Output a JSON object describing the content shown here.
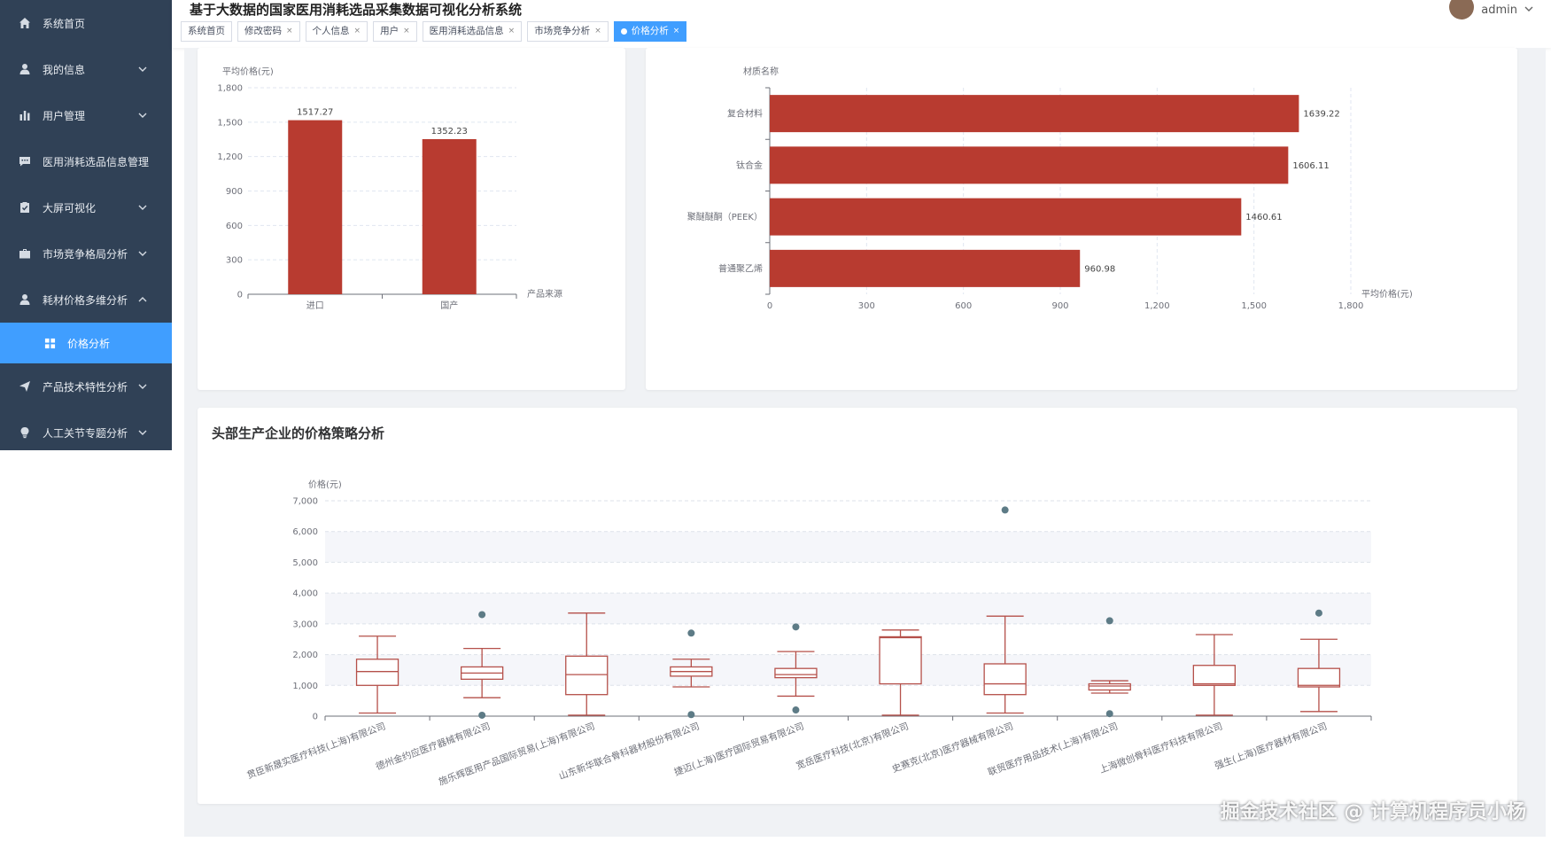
{
  "app": {
    "title": "基于大数据的国家医用消耗选品采集数据可视化分析系统",
    "user": "admin"
  },
  "sidebar": {
    "items": [
      {
        "label": "系统首页",
        "icon": "home-icon",
        "arrow": false
      },
      {
        "label": "我的信息",
        "icon": "user-icon",
        "arrow": true
      },
      {
        "label": "用户管理",
        "icon": "bar-chart-icon",
        "arrow": true
      },
      {
        "label": "医用消耗选品信息管理",
        "icon": "chat-icon",
        "arrow": false
      },
      {
        "label": "大屏可视化",
        "icon": "clipboard-icon",
        "arrow": true
      },
      {
        "label": "市场竞争格局分析",
        "icon": "briefcase-icon",
        "arrow": true
      },
      {
        "label": "耗材价格多维分析",
        "icon": "user-icon",
        "arrow": true,
        "expanded": true
      }
    ],
    "active_sub": {
      "label": "价格分析",
      "icon": "grid-icon"
    },
    "items_after": [
      {
        "label": "产品技术特性分析",
        "icon": "send-icon",
        "arrow": true
      },
      {
        "label": "人工关节专题分析",
        "icon": "bulb-icon",
        "arrow": true
      }
    ]
  },
  "tags": [
    {
      "label": "系统首页",
      "closable": false,
      "active": false
    },
    {
      "label": "修改密码",
      "closable": true,
      "active": false
    },
    {
      "label": "个人信息",
      "closable": true,
      "active": false
    },
    {
      "label": "用户",
      "closable": true,
      "active": false
    },
    {
      "label": "医用消耗选品信息",
      "closable": true,
      "active": false
    },
    {
      "label": "市场竞争分析",
      "closable": true,
      "active": false
    },
    {
      "label": "价格分析",
      "closable": true,
      "active": true
    }
  ],
  "close_glyph": "×",
  "chart_data": [
    {
      "type": "bar",
      "ylabel": "平均价格(元)",
      "xlabel": "产品来源",
      "categories": [
        "进口",
        "国产"
      ],
      "values": [
        1517.27,
        1352.23
      ],
      "value_labels": [
        "1517.27",
        "1352.23"
      ],
      "ylim": [
        0,
        1800
      ],
      "yticks": [
        "0",
        "300",
        "600",
        "900",
        "1,200",
        "1,500",
        "1,800"
      ],
      "ytick_values": [
        0,
        300,
        600,
        900,
        1200,
        1500,
        1800
      ],
      "color": "#b83b30"
    },
    {
      "type": "bar",
      "orientation": "horizontal",
      "ylabel": "材质名称",
      "xlabel": "平均价格(元)",
      "categories": [
        "复合材料",
        "钛合金",
        "聚醚醚酮（PEEK）",
        "普通聚乙烯"
      ],
      "values": [
        1639.22,
        1606.11,
        1460.61,
        960.98
      ],
      "value_labels": [
        "1639.22",
        "1606.11",
        "1460.61",
        "960.98"
      ],
      "xlim": [
        0,
        1800
      ],
      "xticks": [
        "0",
        "300",
        "600",
        "900",
        "1,200",
        "1,500",
        "1,800"
      ],
      "xtick_values": [
        0,
        300,
        600,
        900,
        1200,
        1500,
        1800
      ],
      "color": "#b83b30"
    },
    {
      "type": "boxplot",
      "title": "头部生产企业的价格策略分析",
      "ylabel": "价格(元)",
      "ylim": [
        0,
        7000
      ],
      "yticks": [
        "0",
        "1,000",
        "2,000",
        "3,000",
        "4,000",
        "5,000",
        "6,000",
        "7,000"
      ],
      "ytick_values": [
        0,
        1000,
        2000,
        3000,
        4000,
        5000,
        6000,
        7000
      ],
      "color": "#b5504a",
      "outlier_color": "#5d7b86",
      "categories": [
        "贯臣新晟实医疗科技(上海)有限公司",
        "德州金约应医疗器械有限公司",
        "施乐辉医用产品国际贸易(上海)有限公司",
        "山东新华联合骨科器材股份有限公司",
        "捷迈(上海)医疗国际贸易有限公司",
        "宽岳医疗科技(北京)有限公司",
        "史赛克(北京)医疗器械有限公司",
        "联贸医疗用品技术(上海)有限公司",
        "上海微创骨科医疗科技有限公司",
        "强生(上海)医疗器材有限公司"
      ],
      "boxes": [
        {
          "min": 100,
          "q1": 1000,
          "median": 1450,
          "q3": 1850,
          "max": 2600,
          "outliers": []
        },
        {
          "min": 600,
          "q1": 1200,
          "median": 1400,
          "q3": 1600,
          "max": 2200,
          "outliers": [
            3300,
            30
          ]
        },
        {
          "min": 30,
          "q1": 700,
          "median": 1350,
          "q3": 1950,
          "max": 3350,
          "outliers": []
        },
        {
          "min": 950,
          "q1": 1300,
          "median": 1450,
          "q3": 1600,
          "max": 1850,
          "outliers": [
            2700,
            50
          ]
        },
        {
          "min": 650,
          "q1": 1250,
          "median": 1350,
          "q3": 1550,
          "max": 2100,
          "outliers": [
            2900,
            200
          ]
        },
        {
          "min": 30,
          "q1": 1050,
          "median": 2550,
          "q3": 2580,
          "max": 2800,
          "outliers": []
        },
        {
          "min": 100,
          "q1": 700,
          "median": 1050,
          "q3": 1700,
          "max": 3250,
          "outliers": [
            6700
          ]
        },
        {
          "min": 750,
          "q1": 850,
          "median": 980,
          "q3": 1050,
          "max": 1150,
          "outliers": [
            3100,
            80
          ]
        },
        {
          "min": 30,
          "q1": 1000,
          "median": 1050,
          "q3": 1650,
          "max": 2650,
          "outliers": []
        },
        {
          "min": 150,
          "q1": 950,
          "median": 1000,
          "q3": 1550,
          "max": 2500,
          "outliers": [
            3350
          ]
        }
      ]
    }
  ],
  "watermark": "掘金技术社区 @ 计算机程序员小杨"
}
